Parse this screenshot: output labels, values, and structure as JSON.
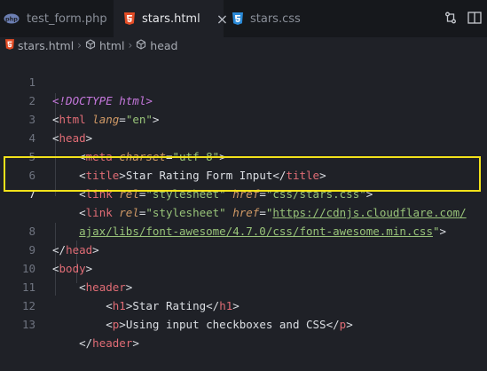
{
  "tabs": [
    {
      "label": "test_form.php",
      "icon": "php-file-icon",
      "active": false
    },
    {
      "label": "stars.html",
      "icon": "html5-file-icon",
      "active": true,
      "close": "×"
    },
    {
      "label": "stars.css",
      "icon": "css3-file-icon",
      "active": false
    }
  ],
  "breadcrumb": [
    {
      "label": "stars.html",
      "icon": "html5-file-icon"
    },
    {
      "label": "html",
      "icon": "symbol-element-icon"
    },
    {
      "label": "head",
      "icon": "symbol-element-icon"
    }
  ],
  "line_numbers": [
    "1",
    "2",
    "3",
    "4",
    "5",
    "6",
    "7",
    "",
    "8",
    "9",
    "10",
    "11",
    "12",
    "13"
  ],
  "lines": {
    "l1_doctype": "<!DOCTYPE html>",
    "l2_open": "<",
    "l2_tag": "html",
    "l2_attr": "lang",
    "l2_eq": "=",
    "l2_val": "\"en\"",
    "l2_close": ">",
    "l3_text": "head",
    "l4_tag": "meta",
    "l4_attr": "charset",
    "l4_val": "\"utf-8\"",
    "l5_tag": "title",
    "l5_text": "Star Rating Form Input",
    "l5_endtag": "title",
    "l6_tag": "link",
    "l6_attr1": "rel",
    "l6_val1": "\"stylesheet\"",
    "l6_attr2": "href",
    "l6_val2": "\"css/stars.css\"",
    "l7_tag": "link",
    "l7_attr1": "rel",
    "l7_val1": "\"stylesheet\"",
    "l7_attr2": "href",
    "l7_val2_open": "\"",
    "l7_url_a": "https://cdnjs.cloudflare.com/",
    "l7_url_b": "ajax/libs/font-awesome/4.7.0/css/font-awesome.min.css",
    "l7_val2_close": "\"",
    "l8_tag": "head",
    "l9_tag": "body",
    "l10_tag": "header",
    "l11_tag": "h1",
    "l11_text": "Star Rating",
    "l12_tag": "p",
    "l12_text": "Using input checkboxes and CSS",
    "l13_tag": "header"
  },
  "colors": {
    "highlight": "#f2e21a",
    "tag": "#e06c75",
    "attribute": "#d19a66",
    "string": "#98c379",
    "background": "#1f2127"
  }
}
